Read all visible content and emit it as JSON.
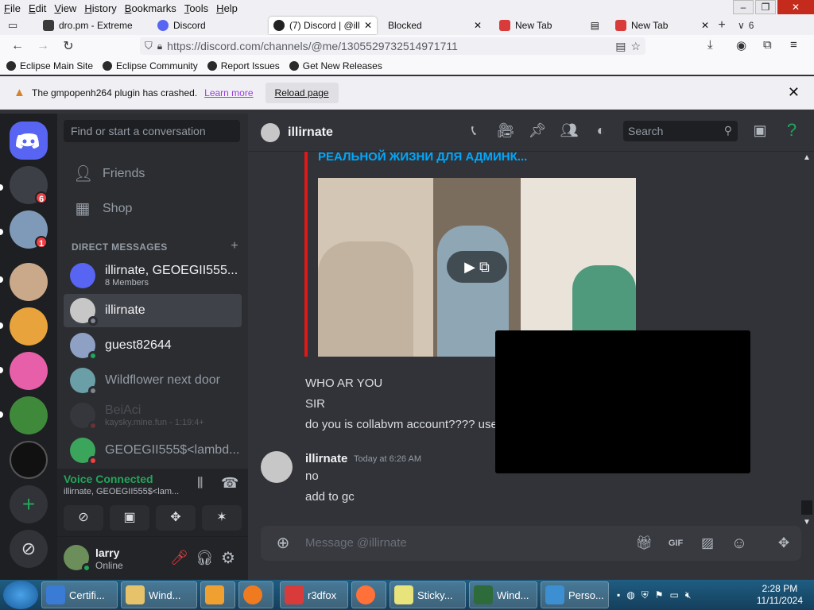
{
  "browser": {
    "menu": [
      "File",
      "Edit",
      "View",
      "History",
      "Bookmarks",
      "Tools",
      "Help"
    ],
    "tabs": [
      {
        "title": "dro.pm - Extreme",
        "active": false
      },
      {
        "title": "Discord",
        "active": false
      },
      {
        "title": "(7) Discord | @illi",
        "active": true
      },
      {
        "title": "Blocked",
        "active": false
      },
      {
        "title": "New Tab",
        "active": false
      },
      {
        "title": "New Tab",
        "active": false
      }
    ],
    "tab_count": "6",
    "url": "https://discord.com/channels/@me/1305529732514971711",
    "bookmarks": [
      "Eclipse Main Site",
      "Eclipse Community",
      "Report Issues",
      "Get New Releases"
    ],
    "notification": {
      "message": "The gmpopenh264 plugin has crashed.",
      "learn_more": "Learn more",
      "reload": "Reload page"
    }
  },
  "discord": {
    "server_badges": [
      "6",
      "1"
    ],
    "dm_search_placeholder": "Find or start a conversation",
    "nav": {
      "friends": "Friends",
      "shop": "Shop"
    },
    "direct_messages_label": "DIRECT MESSAGES",
    "dms": [
      {
        "name": "illirnate, GEOEGII555...",
        "sub": "8 Members",
        "color": "#5865f2",
        "status": ""
      },
      {
        "name": "illirnate",
        "sub": "",
        "color": "#c7c7c7",
        "status": "#80848e",
        "selected": true
      },
      {
        "name": "guest82644",
        "sub": "",
        "color": "#8ea1c4",
        "status": "#23a55a"
      },
      {
        "name": "Wildflower next door",
        "sub": "",
        "color": "#6a9fa8",
        "status": "#80848e"
      },
      {
        "name": "BeiAci",
        "sub": "kaysky.mine.fun - 1:19:4+",
        "color": "#4e5058",
        "status": "#f23f43"
      },
      {
        "name": "GEOEGII555$<lambd...",
        "sub": "",
        "color": "#3ba55c",
        "status": "#f23f43"
      }
    ],
    "voice": {
      "status": "Voice Connected",
      "channel": "illirnate, GEOEGII555$<lam..."
    },
    "user": {
      "name": "larry",
      "status": "Online"
    },
    "chat": {
      "title": "illirnate",
      "search_placeholder": "Search",
      "embed_title": "РЕАЛЬНОЙ ЖИЗНИ ДЛЯ АДМИНК...",
      "messages_top": [
        "WHO AR YOU",
        "SIR",
        "do you is collabvm account???? use"
      ],
      "message_group": {
        "author": "illirnate",
        "time": "Today at 6:26 AM",
        "lines": [
          "no",
          "add to gc"
        ]
      },
      "composer_placeholder": "Message @illirnate"
    }
  },
  "taskbar": {
    "items": [
      "Certifi...",
      "Wind...",
      "",
      "",
      "r3dfox",
      "",
      "Sticky...",
      "Wind...",
      "Perso..."
    ],
    "time": "2:28 PM",
    "date": "11/11/2024"
  },
  "colors": {
    "discord_blurple": "#5865f2",
    "online": "#23a55a",
    "dnd": "#f23f43",
    "embed_bar": "#e01818",
    "link": "#00a8fc"
  }
}
